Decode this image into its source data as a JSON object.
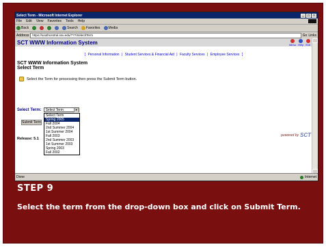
{
  "browser": {
    "window_title": "Select Term - Microsoft Internet Explorer",
    "menu": [
      "File",
      "Edit",
      "View",
      "Favorites",
      "Tools",
      "Help"
    ],
    "toolbar": [
      {
        "label": "Back",
        "icon": "back-arrow-icon",
        "color": "#2f7d2f"
      },
      {
        "label": "",
        "icon": "forward-arrow-icon",
        "color": "#2f7d2f"
      },
      {
        "label": "",
        "icon": "stop-icon",
        "color": "#c03030"
      },
      {
        "label": "",
        "icon": "refresh-icon",
        "color": "#2f7d2f"
      },
      {
        "label": "",
        "icon": "home-icon",
        "color": "#4a6ab0"
      },
      {
        "label": "Search",
        "icon": "search-icon",
        "color": "#4a6ab0"
      },
      {
        "label": "Favorites",
        "icon": "favorites-star-icon",
        "color": "#d6a020"
      },
      {
        "label": "Media",
        "icon": "media-icon",
        "color": "#4a6ab0"
      }
    ],
    "address_label": "Address",
    "address_value": "https://southcentral.ssu.edu/???/Select/Term",
    "go_label": "Go",
    "links_label": "Links",
    "status_text": "Done",
    "zone_text": "Internet"
  },
  "page": {
    "header_title": "SCT WWW Information System",
    "header_links": [
      {
        "label": "Menu",
        "icon": "menu-icon",
        "color": "#d03030"
      },
      {
        "label": "Help",
        "icon": "help-icon",
        "color": "#3050c0"
      },
      {
        "label": "Exit",
        "icon": "exit-icon",
        "color": "#d03030"
      }
    ],
    "nav_links": [
      "Personal Information",
      "Student Services & Financial Aid",
      "Faculty Services",
      "Employee Services"
    ],
    "system_title": "SCT WWW Information System",
    "system_subtitle": "Select Term",
    "instruction": "Select the Term for processing then press the Submit Term button.",
    "select_label": "Select Term:",
    "select_value": "Select Term",
    "term_options": [
      "Select Term",
      "Spring 2005",
      "Fall 2004",
      "2nd Summer 2004",
      "1st Summer 2004",
      "Fall 2003",
      "2nd Summer 2003",
      "1st Summer 2003",
      "Spring 2003",
      "Fall 2002"
    ],
    "highlighted_option_index": 1,
    "submit_label": "Submit Term",
    "release": "Release: 5.1",
    "powered_by": "powered by",
    "powered_logo": "SCT"
  },
  "slide": {
    "step_title": "STEP 9",
    "step_text": "Select the term from the drop-down box and click on Submit Term."
  }
}
